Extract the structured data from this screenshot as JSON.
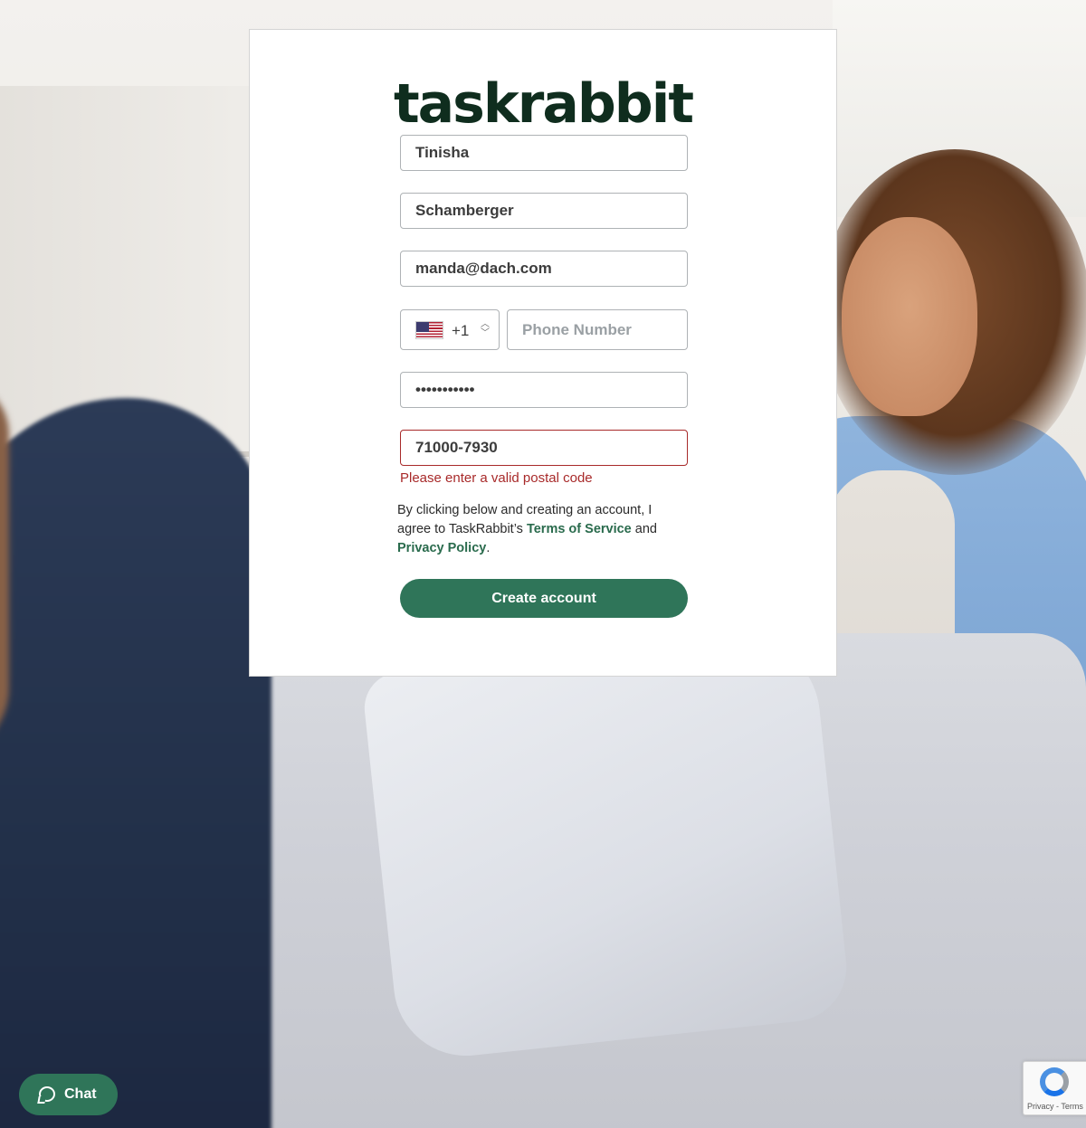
{
  "brand": {
    "logo_text": "taskrabbit",
    "accent": "#2f7559",
    "error_color": "#a82a2a"
  },
  "form": {
    "first_name": "Tinisha",
    "last_name": "Schamberger",
    "email": "manda@dach.com",
    "phone": {
      "country_flag": "us-flag-icon",
      "dial_code": "+1",
      "placeholder": "Phone Number"
    },
    "password_mask": "•••••••••••",
    "postal_code": "71000-7930",
    "postal_error": "Please enter a valid postal code",
    "terms": {
      "prefix": "By clicking below and creating an account, I agree to TaskRabbit’s ",
      "terms_link": "Terms of Service",
      "middle": " and ",
      "privacy_link": "Privacy Policy",
      "suffix": "."
    },
    "submit_label": "Create account"
  },
  "chat": {
    "label": "Chat",
    "icon": "chat-bubble-icon"
  },
  "recaptcha": {
    "text": "Privacy - Terms"
  }
}
